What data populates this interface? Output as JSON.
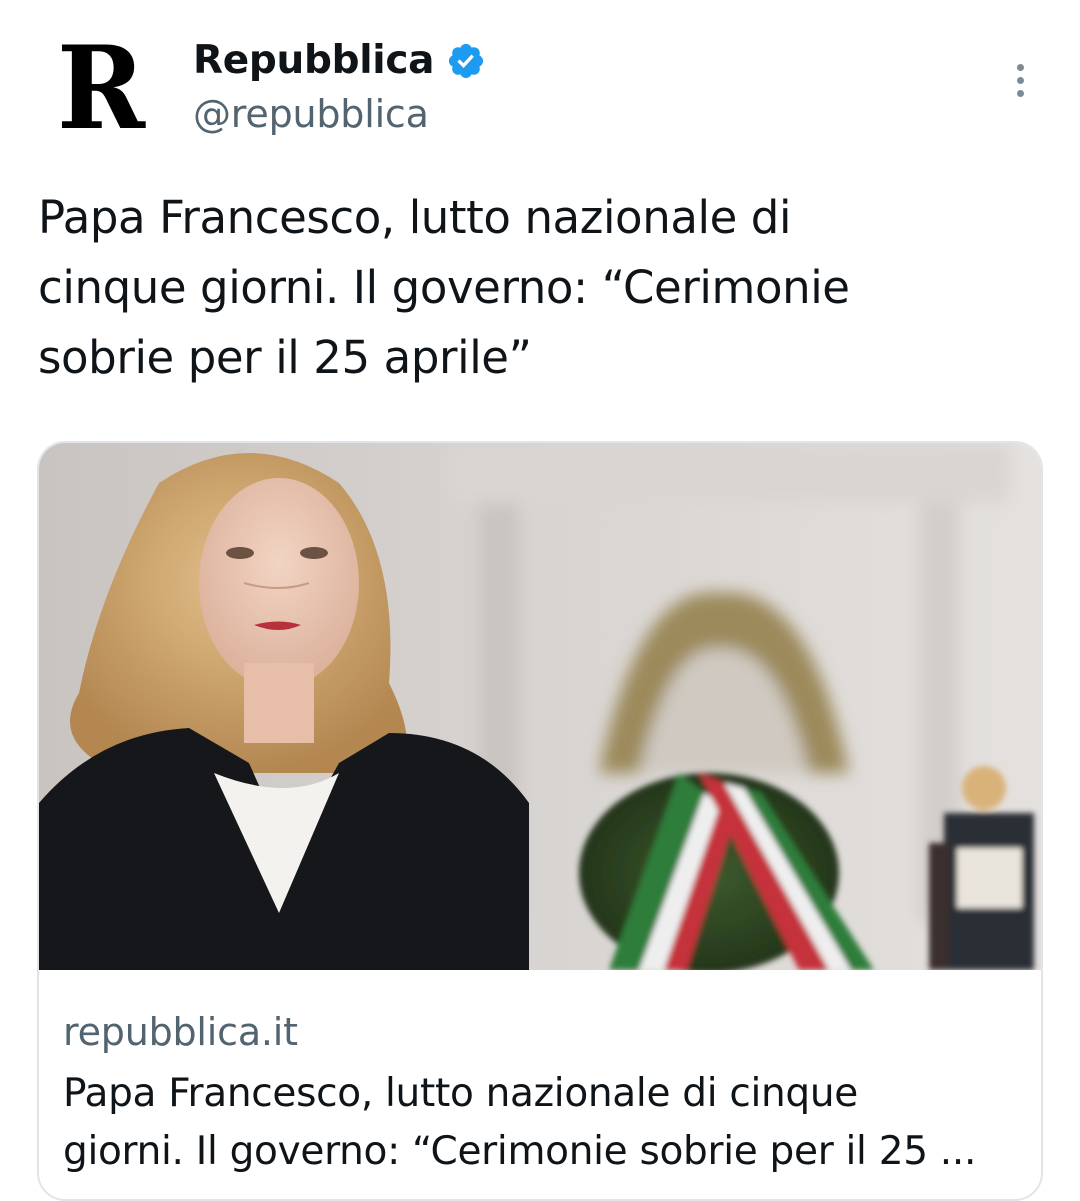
{
  "account": {
    "avatar_letter": "R",
    "display_name": "Repubblica",
    "handle": "@repubblica",
    "verified": true,
    "verified_color": "#1d9bf0"
  },
  "tweet": {
    "text": "Papa Francesco, lutto nazionale di\ncinque giorni. Il governo: “Cerimonie\nsobrie per il 25 aprile”"
  },
  "link_card": {
    "domain": "repubblica.it",
    "title": "Papa Francesco, lutto nazionale di cinque\ngiorni. Il governo: “Cerimonie sobrie per il 25 ...",
    "image_alt": "woman-in-black-blazer-at-ceremony-with-wreath"
  },
  "icons": {
    "verified": "verified-badge-icon",
    "more": "more-vertical-icon"
  }
}
